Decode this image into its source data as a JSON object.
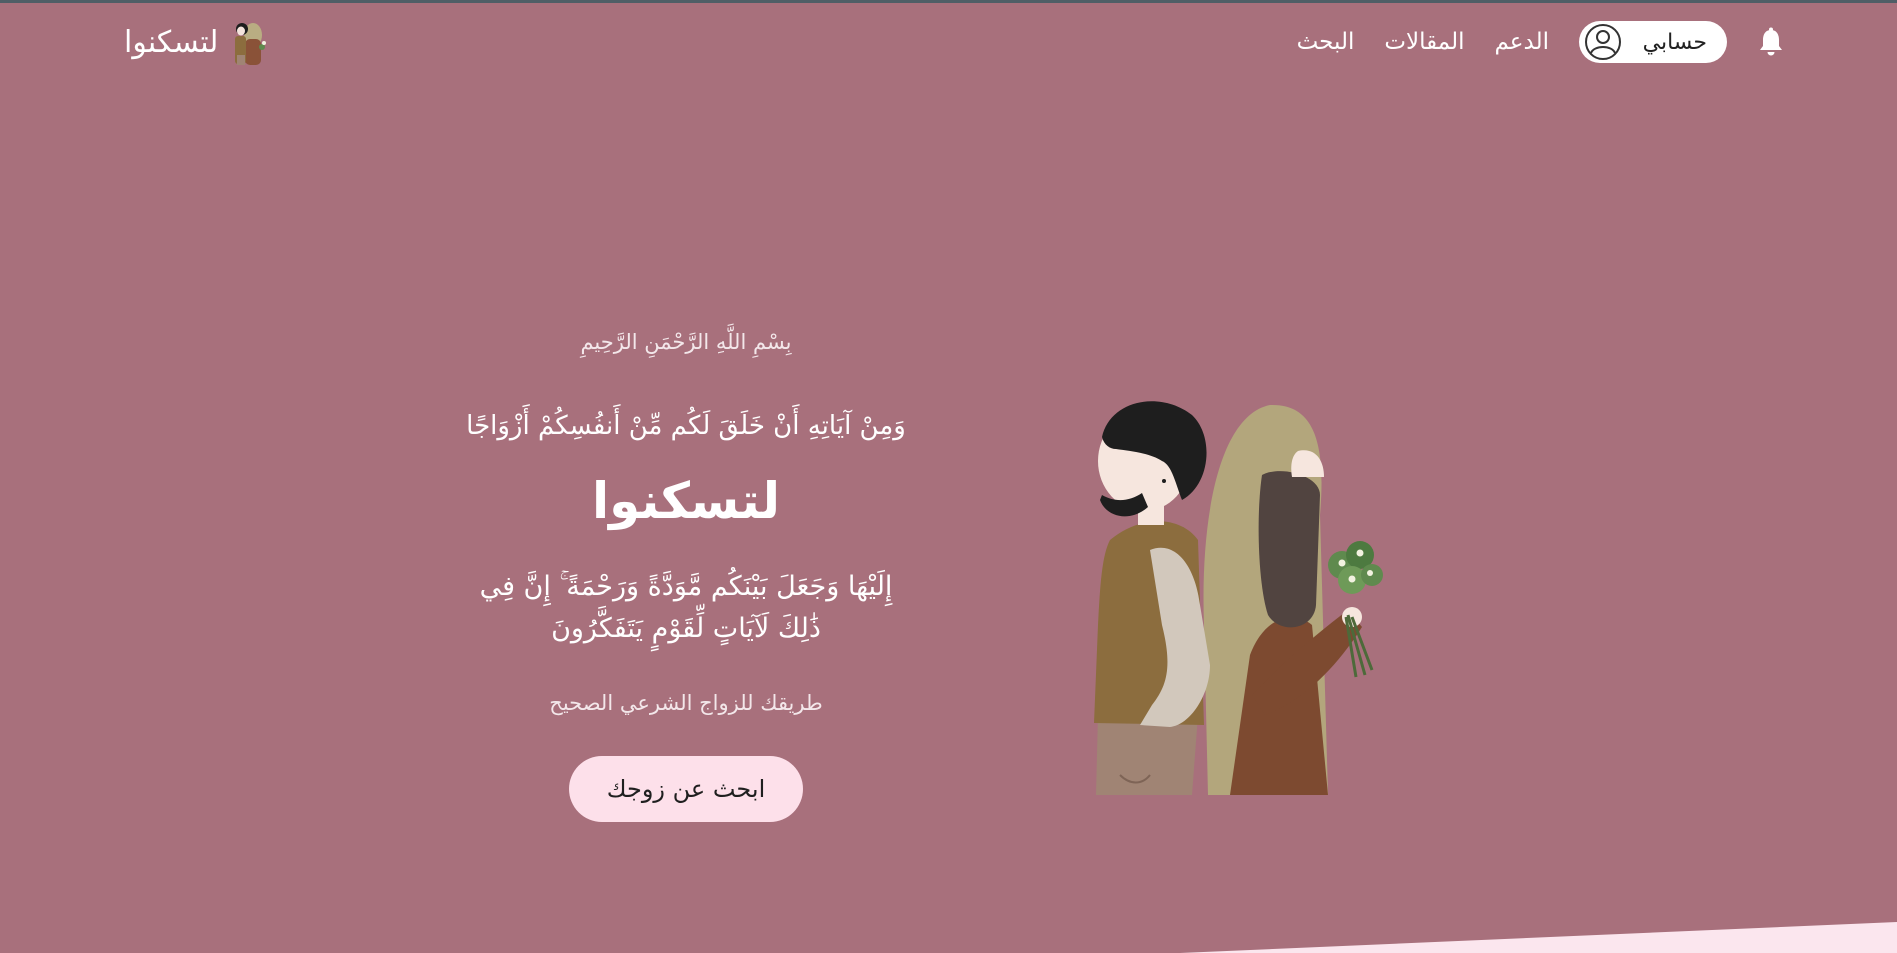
{
  "brand": {
    "name": "لتسكنوا"
  },
  "nav": {
    "links": [
      {
        "label": "البحث"
      },
      {
        "label": "المقالات"
      },
      {
        "label": "الدعم"
      }
    ],
    "account_label": "حسابي"
  },
  "hero": {
    "basmala": "بِسْمِ اللَّهِ الرَّحْمَنِ الرَّحِيمِ",
    "verse_line1": "وَمِنْ آيَاتِهِ أَنْ خَلَقَ لَكُم مِّنْ أَنفُسِكُمْ أَزْوَاجًا",
    "title": "لتسكنوا",
    "verse_line2": "إِلَيْهَا وَجَعَلَ بَيْنَكُم مَّوَدَّةً وَرَحْمَةً ۚ إِنَّ فِي ذَٰلِكَ لَآيَاتٍ لِّقَوْمٍ يَتَفَكَّرُونَ",
    "tagline": "طريقك للزواج الشرعي الصحيح",
    "cta_label": "ابحث عن زوجك"
  },
  "icons": {
    "bell": "bell-icon",
    "avatar": "user-avatar-icon",
    "logo": "couple-logo-icon",
    "illustration": "couple-illustration"
  },
  "colors": {
    "background": "#a8707c",
    "cta_background": "#fde0ea",
    "wave": "#fbe6ee"
  }
}
